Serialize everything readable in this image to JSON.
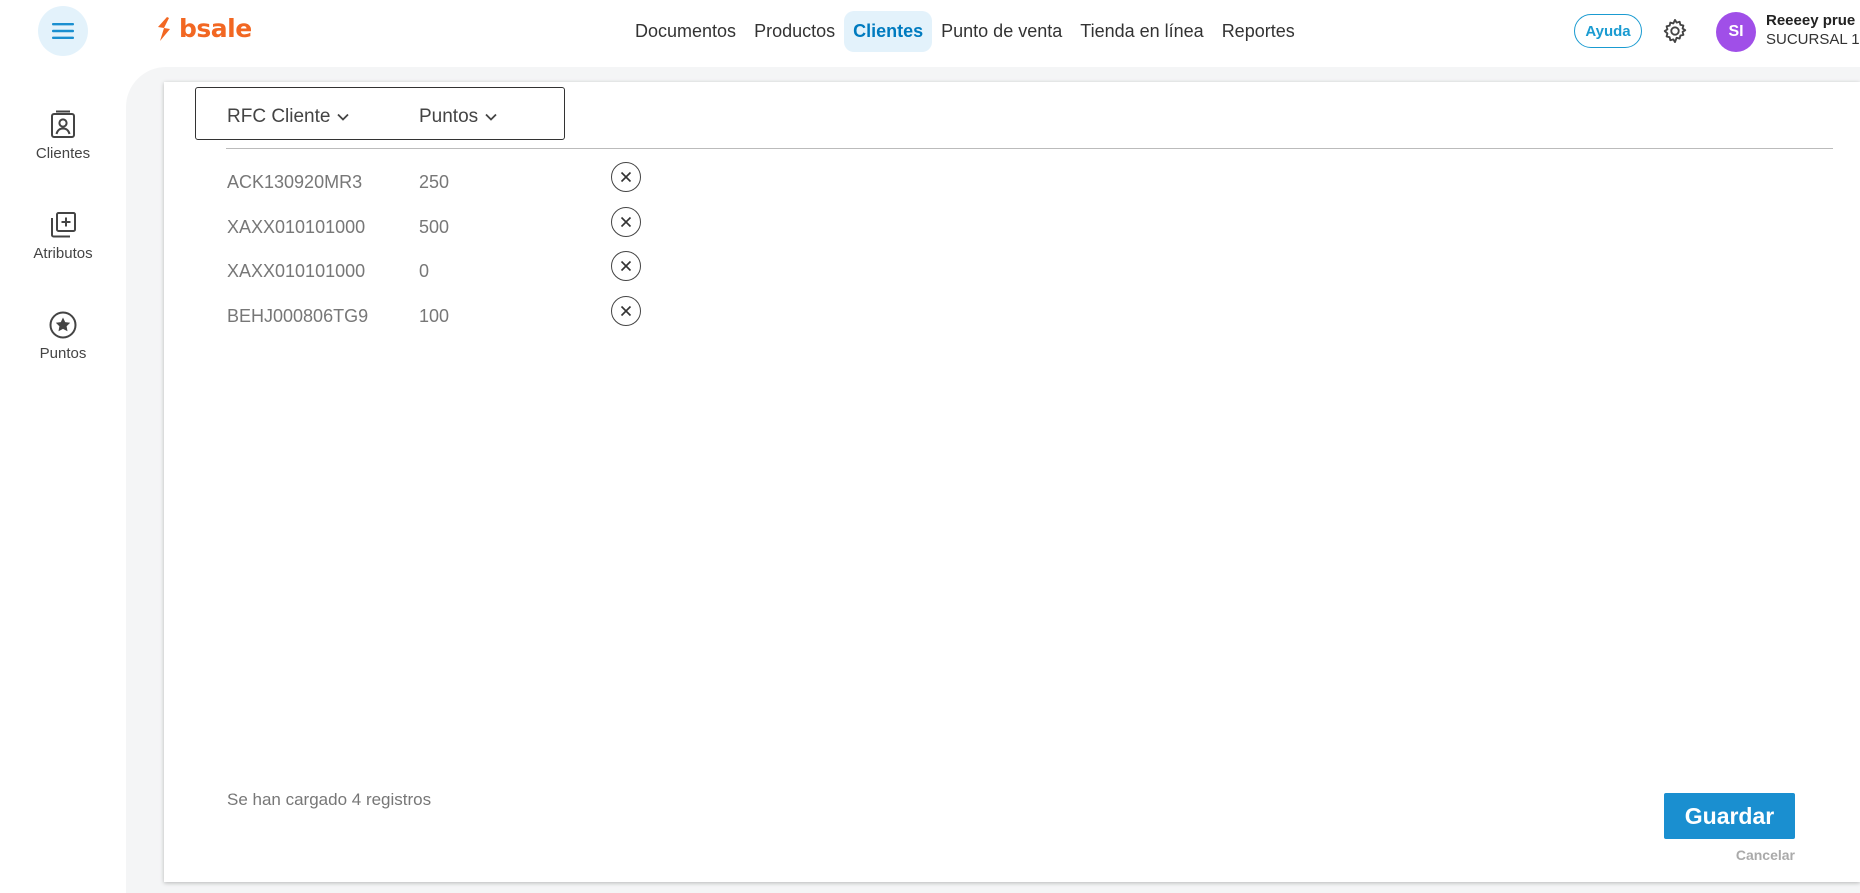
{
  "brand": {
    "name": "bsale",
    "color": "#f26722"
  },
  "nav": {
    "items": [
      {
        "label": "Documentos",
        "active": false
      },
      {
        "label": "Productos",
        "active": false
      },
      {
        "label": "Clientes",
        "active": true
      },
      {
        "label": "Punto de venta",
        "active": false
      },
      {
        "label": "Tienda en línea",
        "active": false
      },
      {
        "label": "Reportes",
        "active": false
      }
    ]
  },
  "header": {
    "help_label": "Ayuda",
    "avatar_initials": "SI",
    "user_name": "Reeeey prue",
    "user_branch": "SUCURSAL 1"
  },
  "sidebar": {
    "items": [
      {
        "label": "Clientes",
        "icon": "contact-card-icon"
      },
      {
        "label": "Atributos",
        "icon": "add-box-icon"
      },
      {
        "label": "Puntos",
        "icon": "star-circle-icon"
      }
    ]
  },
  "table": {
    "columns": [
      {
        "label": "RFC Cliente"
      },
      {
        "label": "Puntos"
      }
    ],
    "rows": [
      {
        "rfc": "ACK130920MR3",
        "puntos": "250"
      },
      {
        "rfc": "XAXX010101000",
        "puntos": "500"
      },
      {
        "rfc": "XAXX010101000",
        "puntos": "0"
      },
      {
        "rfc": "BEHJ000806TG9",
        "puntos": "100"
      }
    ]
  },
  "footer": {
    "status": "Se han cargado 4 registros",
    "save_label": "Guardar",
    "cancel_label": "Cancelar"
  },
  "colors": {
    "accent": "#1a8fd0",
    "active_nav_bg": "#e3f2fb",
    "avatar_bg": "#a04fe8"
  }
}
